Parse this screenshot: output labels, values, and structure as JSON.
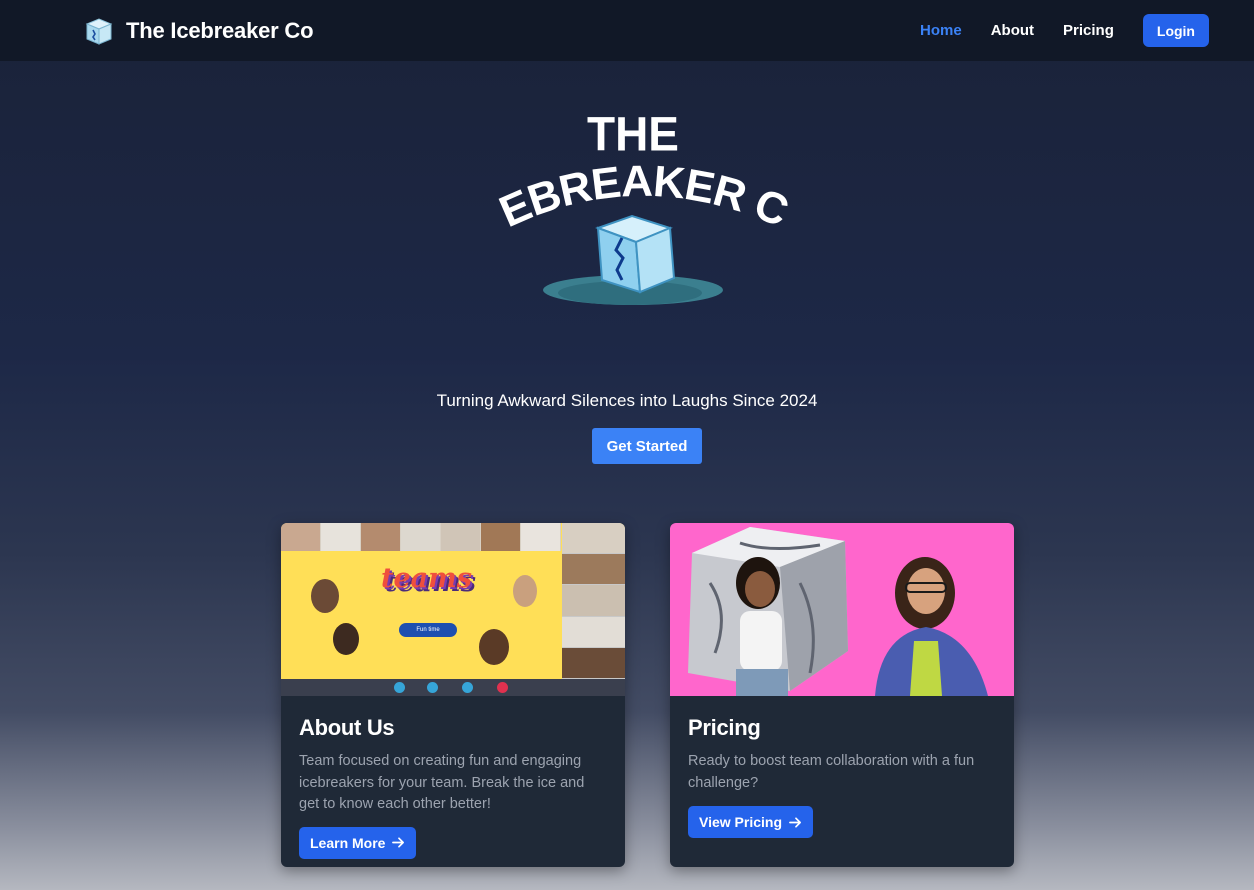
{
  "nav": {
    "brand": "The Icebreaker Co",
    "links": [
      {
        "label": "Home",
        "active": true
      },
      {
        "label": "About",
        "active": false
      },
      {
        "label": "Pricing",
        "active": false
      }
    ],
    "login_label": "Login"
  },
  "hero": {
    "logo_line1": "THE",
    "logo_line2": "ICEBREAKER CO.",
    "tagline": "Turning Awkward Silences into Laughs Since 2024",
    "cta_label": "Get Started"
  },
  "cards": {
    "about": {
      "title": "About Us",
      "text": "Team focused on creating fun and engaging icebreakers for your team. Break the ice and get to know each other better!",
      "button_label": "Learn More",
      "image_word": "teams",
      "image_button": "Fun time"
    },
    "pricing": {
      "title": "Pricing",
      "text": "Ready to boost team collaboration with a fun challenge?",
      "button_label": "View Pricing"
    }
  },
  "colors": {
    "nav_bg": "#111827",
    "accent": "#3b82f6",
    "button": "#2563eb",
    "card_bg": "#1f2937",
    "pricing_image_bg": "#ff66cc",
    "teams_image_bg": "#ffdf57"
  }
}
